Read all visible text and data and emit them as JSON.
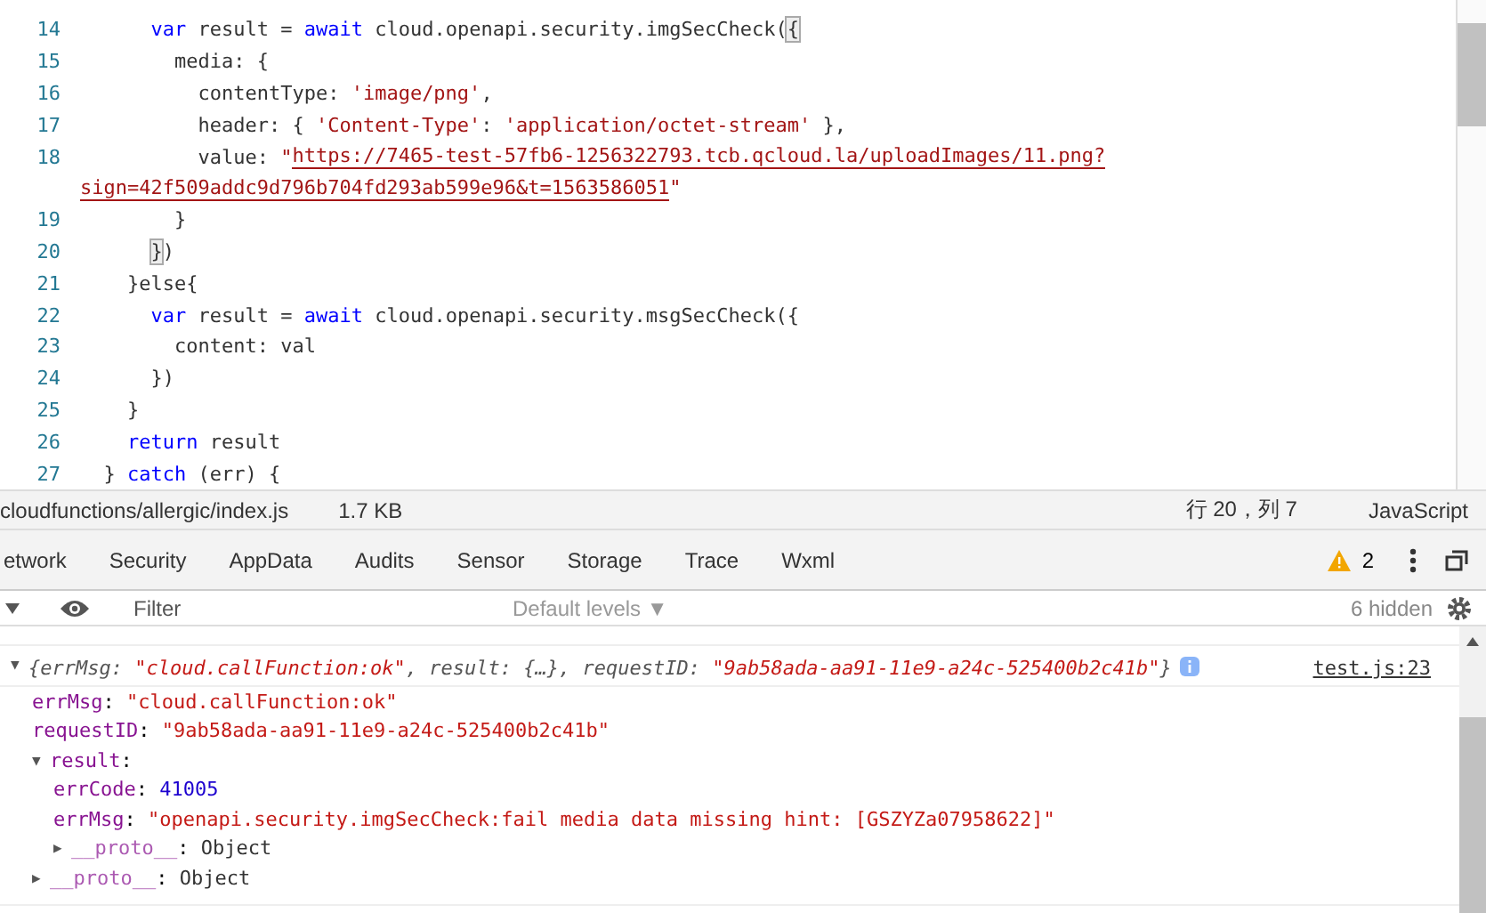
{
  "editor": {
    "lines": [
      {
        "number": "14",
        "tokens": [
          {
            "kind": "kw",
            "text": "      var"
          },
          {
            "kind": "plain",
            "text": " result = "
          },
          {
            "kind": "kw",
            "text": "await"
          },
          {
            "kind": "plain",
            "text": " cloud.openapi.security.imgSecCheck("
          },
          {
            "kind": "match",
            "text": "{"
          }
        ]
      },
      {
        "number": "15",
        "tokens": [
          {
            "kind": "plain",
            "text": "        media: {"
          }
        ]
      },
      {
        "number": "16",
        "tokens": [
          {
            "kind": "plain",
            "text": "          contentType: "
          },
          {
            "kind": "str",
            "text": "'image/png'"
          },
          {
            "kind": "plain",
            "text": ","
          }
        ]
      },
      {
        "number": "17",
        "tokens": [
          {
            "kind": "plain",
            "text": "          header: { "
          },
          {
            "kind": "str",
            "text": "'Content-Type'"
          },
          {
            "kind": "plain",
            "text": ": "
          },
          {
            "kind": "str",
            "text": "'application/octet-stream'"
          },
          {
            "kind": "plain",
            "text": " },"
          }
        ]
      },
      {
        "number": "18",
        "tokens": [
          {
            "kind": "plain",
            "text": "          value: "
          },
          {
            "kind": "str",
            "text": "\""
          },
          {
            "kind": "url",
            "text": "https://7465-test-57fb6-1256322793.tcb.qcloud.la/uploadImages/11.png?"
          }
        ],
        "wrapped": [
          {
            "kind": "url",
            "text": "sign=42f509addc9d796b704fd293ab599e96&t=1563586051"
          },
          {
            "kind": "str",
            "text": "\""
          }
        ]
      },
      {
        "number": "19",
        "tokens": [
          {
            "kind": "plain",
            "text": "        }"
          }
        ]
      },
      {
        "number": "20",
        "tokens": [
          {
            "kind": "match",
            "text": "      }"
          },
          {
            "kind": "plain",
            "text": ")"
          }
        ]
      },
      {
        "number": "21",
        "tokens": [
          {
            "kind": "plain",
            "text": "    }else{"
          }
        ]
      },
      {
        "number": "22",
        "tokens": [
          {
            "kind": "kw",
            "text": "      var"
          },
          {
            "kind": "plain",
            "text": " result = "
          },
          {
            "kind": "kw",
            "text": "await"
          },
          {
            "kind": "plain",
            "text": " cloud.openapi.security.msgSecCheck({"
          }
        ]
      },
      {
        "number": "23",
        "tokens": [
          {
            "kind": "plain",
            "text": "        content: val"
          }
        ]
      },
      {
        "number": "24",
        "tokens": [
          {
            "kind": "plain",
            "text": "      })"
          }
        ]
      },
      {
        "number": "25",
        "tokens": [
          {
            "kind": "plain",
            "text": "    }"
          }
        ]
      },
      {
        "number": "26",
        "tokens": [
          {
            "kind": "kw",
            "text": "    return"
          },
          {
            "kind": "plain",
            "text": " result"
          }
        ]
      },
      {
        "number": "27",
        "tokens": [
          {
            "kind": "plain",
            "text": "  } "
          },
          {
            "kind": "kw",
            "text": "catch"
          },
          {
            "kind": "plain",
            "text": " (err) {"
          }
        ]
      }
    ]
  },
  "status_bar": {
    "file": "cloudfunctions/allergic/index.js",
    "size": "1.7 KB",
    "position": "行 20，列 7",
    "language": "JavaScript"
  },
  "devtools_tabs": [
    {
      "label": "etwork",
      "selected": false
    },
    {
      "label": "Security",
      "selected": false
    },
    {
      "label": "AppData",
      "selected": false
    },
    {
      "label": "Audits",
      "selected": false
    },
    {
      "label": "Sensor",
      "selected": false
    },
    {
      "label": "Storage",
      "selected": false
    },
    {
      "label": "Trace",
      "selected": false
    },
    {
      "label": "Wxml",
      "selected": false
    }
  ],
  "warnings_count": "2",
  "console_toolbar": {
    "filter_placeholder": "Filter",
    "levels": "Default levels",
    "levels_caret": "▼",
    "hidden": "6 hidden"
  },
  "console": {
    "expanded_marker": "▼",
    "collapsed_marker": "▶",
    "separator": ":",
    "summary": [
      {
        "kind": "punct",
        "text": "{errMsg: "
      },
      {
        "kind": "str",
        "text": "\"cloud.callFunction:ok\""
      },
      {
        "kind": "punct",
        "text": ", result: {…}, requestID: "
      },
      {
        "kind": "str",
        "text": "\"9ab58ada-aa91-11e9-a24c-525400b2c41b\""
      },
      {
        "kind": "punct",
        "text": "}"
      }
    ],
    "source": "test.js:23",
    "expanded": true,
    "properties": [
      {
        "key": "errMsg",
        "value": "\"cloud.callFunction:ok\"",
        "kind": "string"
      },
      {
        "key": "requestID",
        "value": "\"9ab58ada-aa91-11e9-a24c-525400b2c41b\"",
        "kind": "string"
      },
      {
        "key": "result",
        "kind": "object",
        "expanded": true,
        "children": [
          {
            "key": "errCode",
            "value": "41005",
            "kind": "number"
          },
          {
            "key": "errMsg",
            "value": "\"openapi.security.imgSecCheck:fail media data missing hint: [GSZYZa07958622]\"",
            "kind": "string"
          },
          {
            "key": "__proto__",
            "value": "Object",
            "kind": "object",
            "expanded": false
          }
        ]
      },
      {
        "key": "__proto__",
        "value": "Object",
        "kind": "object",
        "expanded": false
      }
    ]
  }
}
